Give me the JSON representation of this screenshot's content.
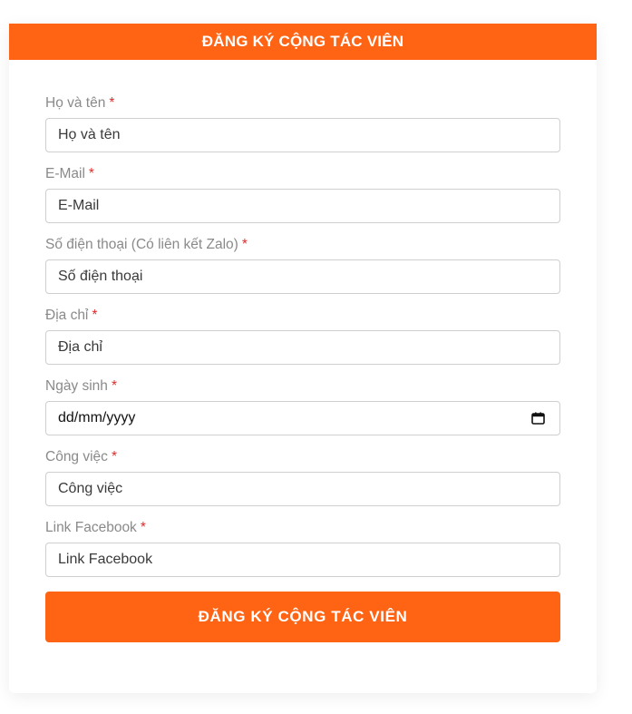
{
  "header": {
    "title": "ĐĂNG KÝ CỘNG TÁC VIÊN"
  },
  "form": {
    "required_marker": "*",
    "fields": [
      {
        "label": "Họ và tên",
        "placeholder": "Họ và tên"
      },
      {
        "label": "E-Mail",
        "placeholder": "E-Mail"
      },
      {
        "label": "Số điện thoại (Có liên kết Zalo)",
        "placeholder": "Số điện thoại"
      },
      {
        "label": "Địa chỉ",
        "placeholder": "Địa chỉ"
      },
      {
        "label": "Ngày sinh",
        "value": "dd/mm/yyyy",
        "icon": "calendar-icon"
      },
      {
        "label": "Công việc",
        "placeholder": "Công việc"
      },
      {
        "label": "Link Facebook",
        "placeholder": "Link Facebook"
      }
    ],
    "submit_label": "ĐĂNG KÝ CỘNG TÁC VIÊN"
  },
  "colors": {
    "accent": "#ff6314",
    "required": "#e02b2b",
    "label": "#8a8a8a",
    "border": "#cfcfcf"
  }
}
